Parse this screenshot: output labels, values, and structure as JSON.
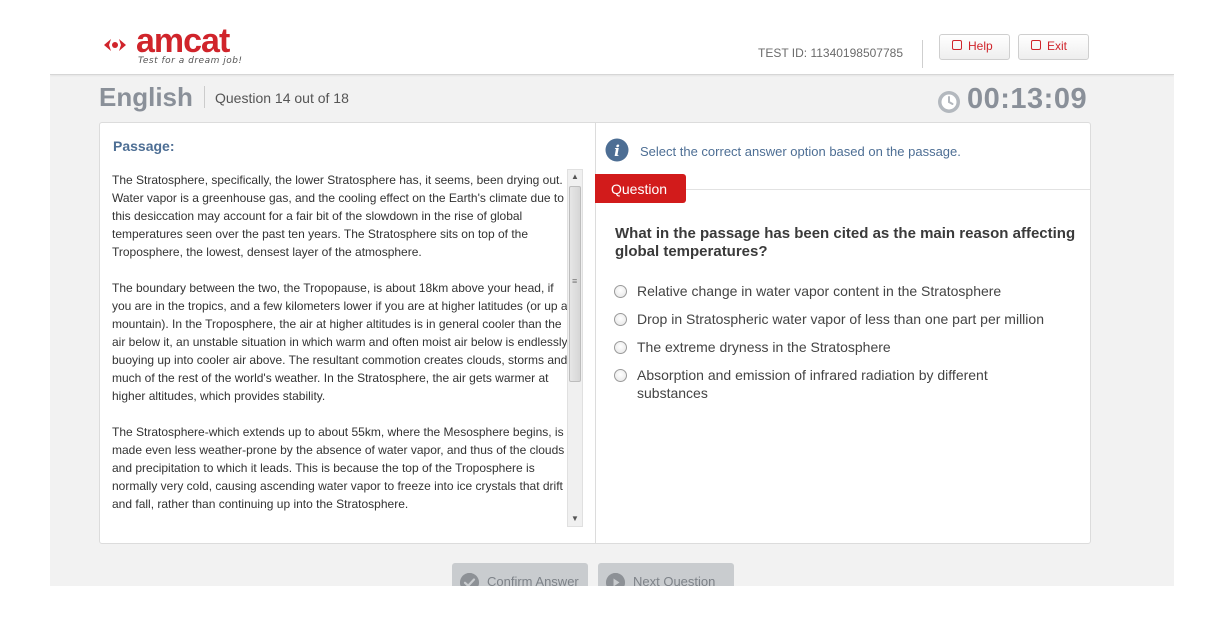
{
  "header": {
    "logo_text": "amcat",
    "logo_tagline": "Test for a dream job!",
    "test_id": "TEST ID: 11340198507785",
    "help_label": "Help",
    "exit_label": "Exit"
  },
  "section": {
    "title": "English",
    "question_counter": "Question 14 out of 18",
    "timer": "00:13:09"
  },
  "passage": {
    "label": "Passage:",
    "paragraphs": [
      "The Stratosphere, specifically, the lower Stratosphere has, it seems, been drying out. Water vapor is a greenhouse gas, and the cooling effect on the Earth's climate due to this desiccation may account for a fair bit of the slowdown in the rise of global temperatures seen over the past ten years. The Stratosphere sits on top of the Troposphere, the lowest, densest layer of the atmosphere.",
      "The boundary between the two, the Tropopause, is about 18km above your head, if you are in the tropics, and a few kilometers lower if you are at higher latitudes (or up a mountain). In the Troposphere, the air at higher altitudes is in general cooler than the air below it, an unstable situation in which warm and often moist air below is endlessly buoying up into cooler air above. The resultant commotion creates clouds, storms and much of the rest of the world's weather. In the Stratosphere, the air gets warmer at higher altitudes, which provides stability.",
      "The Stratosphere-which extends up to about 55km, where the Mesosphere begins, is made even less weather-prone by the absence of water vapor, and thus of the clouds and precipitation to which it leads. This is because the top of the Troposphere is normally very cold, causing ascending water vapor to freeze into ice crystals that drift and fall, rather than continuing up into the Stratosphere."
    ]
  },
  "question": {
    "instruction": "Select the correct answer option based on the passage.",
    "tab_label": "Question",
    "text": "What in the passage has been cited as the main reason affecting global temperatures?",
    "options": [
      "Relative change in water vapor content in the Stratosphere",
      "Drop in Stratospheric water vapor of less than one part per million",
      "The extreme dryness in the Stratosphere",
      "Absorption and emission of infrared radiation by different substances"
    ]
  },
  "footer": {
    "confirm_label": "Confirm Answer",
    "next_label": "Next Question"
  },
  "colors": {
    "brand_red": "#d21b1b",
    "muted_blue": "#4d6e94",
    "heading_gray": "#8a9099"
  },
  "icons": [
    "logo-mark-icon",
    "clock-icon",
    "info-icon",
    "check-icon",
    "play-icon"
  ]
}
